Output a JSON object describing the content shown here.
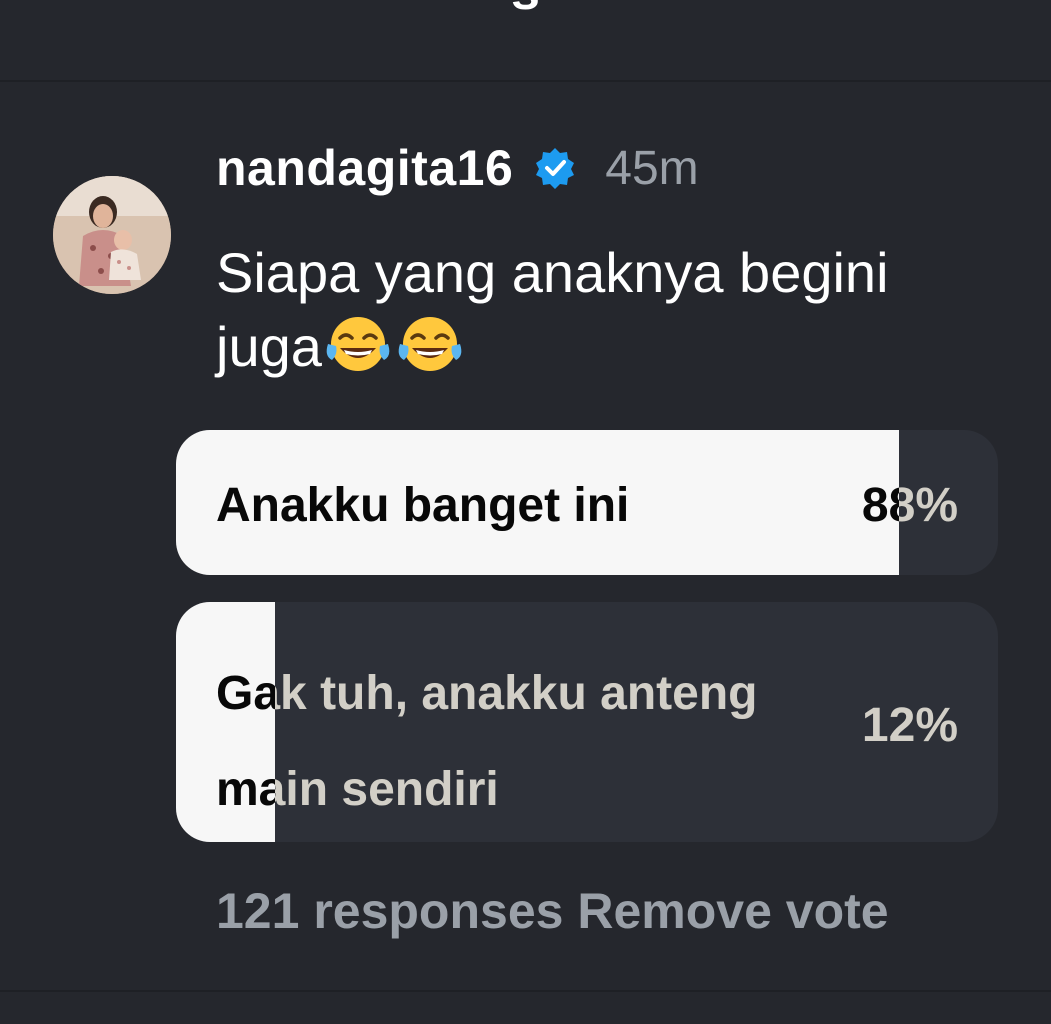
{
  "header_partial": "s",
  "post": {
    "username": "nandagita16",
    "verified": true,
    "timestamp": "45m",
    "text": "Siapa yang anaknya begini juga",
    "emoji_icon": "face-with-tears-of-joy-icon"
  },
  "poll": {
    "options": [
      {
        "label": "Anakku banget ini",
        "percent_text": "88%",
        "percent": 88
      },
      {
        "label": "Gak tuh, anakku anteng main sendiri",
        "percent_text": "12%",
        "percent": 12
      }
    ],
    "responses": "121 responses",
    "remove_vote": "Remove vote"
  },
  "colors": {
    "background": "#25272d",
    "option_track": "#2d3038",
    "option_fill": "#f7f7f7",
    "muted_text": "#9aa0a8",
    "verified_badge": "#1d9bf0"
  }
}
